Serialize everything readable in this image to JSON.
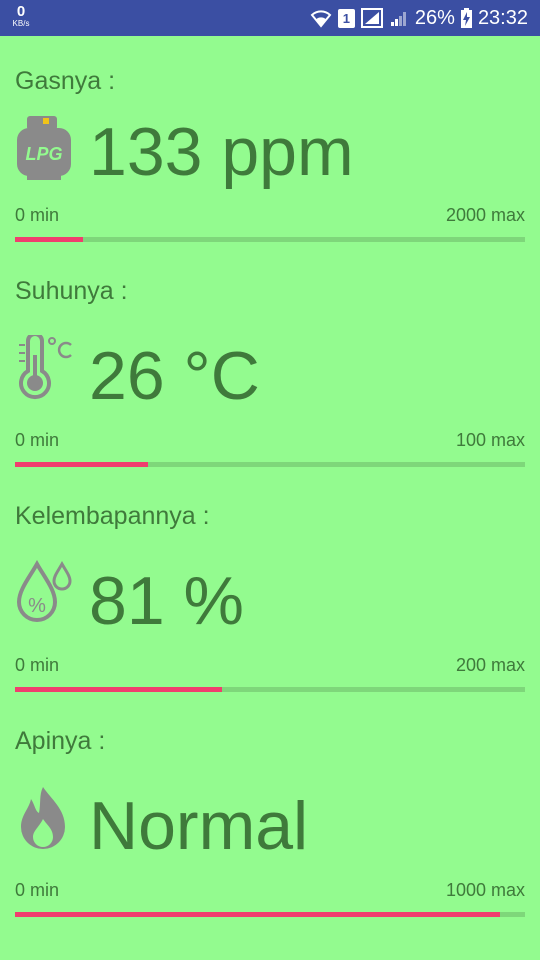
{
  "status_bar": {
    "speed_value": "0",
    "speed_unit": "KB/s",
    "sim_label": "1",
    "battery_percent": "26%",
    "time": "23:32",
    "icons": [
      "wifi-icon",
      "sim-icon",
      "signal-icon",
      "signal-weak-icon",
      "battery-charging-icon"
    ]
  },
  "sensors": [
    {
      "label": "Gasnya :",
      "icon": "lpg-tank-icon",
      "value": "133 ppm",
      "min_label": "0 min",
      "max_label": "2000 max",
      "progress_fraction": 0.1333
    },
    {
      "label": "Suhunya :",
      "icon": "thermometer-celsius-icon",
      "value": "26 °C",
      "min_label": "0 min",
      "max_label": "100 max",
      "progress_fraction": 0.26
    },
    {
      "label": "Kelembapannya :",
      "icon": "humidity-drop-icon",
      "value": "81 %",
      "min_label": "0 min",
      "max_label": "200 max",
      "progress_fraction": 0.405
    },
    {
      "label": "Apinya :",
      "icon": "flame-icon",
      "value": "Normal",
      "min_label": "0 min",
      "max_label": "1000 max",
      "progress_fraction": 0.95
    }
  ],
  "colors": {
    "background": "#93fb8f",
    "status_bar": "#3b4fa3",
    "text": "#3f7a3b",
    "progress_fill": "#f03e6e",
    "progress_track": "#7ed77a",
    "icon_gray": "#8a8a8a"
  }
}
